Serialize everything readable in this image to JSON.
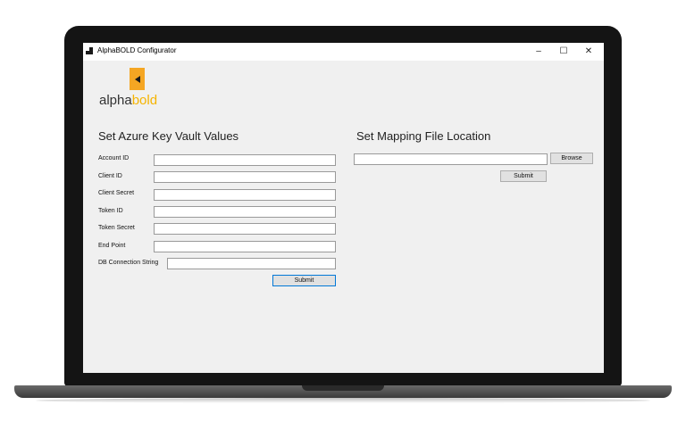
{
  "window": {
    "title": "AlphaBOLD Configurator",
    "minimize": "–",
    "maximize": "☐",
    "close": "✕"
  },
  "logo": {
    "text_part1": "alpha",
    "text_part2": "bold",
    "mark_color": "#f5a623",
    "text_color": "#f5b400"
  },
  "azure": {
    "title": "Set Azure Key Vault Values",
    "fields": [
      {
        "label": "Account ID",
        "value": ""
      },
      {
        "label": "Client ID",
        "value": ""
      },
      {
        "label": "Client Secret",
        "value": ""
      },
      {
        "label": "Token ID",
        "value": ""
      },
      {
        "label": "Token Secret",
        "value": ""
      },
      {
        "label": "End Point",
        "value": ""
      },
      {
        "label": "DB Connection String",
        "value": ""
      }
    ],
    "submit_label": "Submit"
  },
  "mapping": {
    "title": "Set Mapping File Location",
    "path_value": "",
    "browse_label": "Browse",
    "submit_label": "Submit"
  }
}
